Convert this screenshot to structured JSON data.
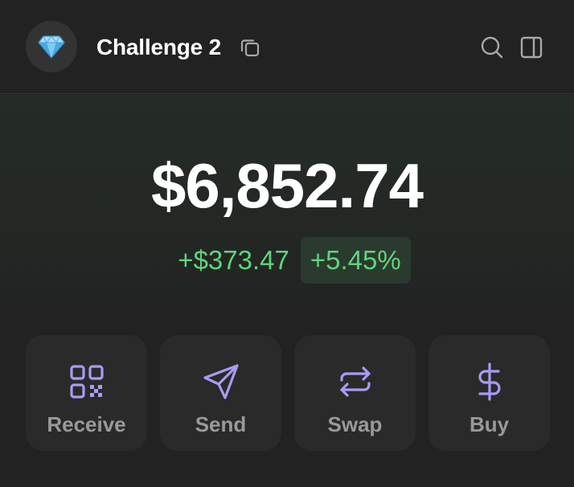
{
  "header": {
    "account_name": "Challenge 2",
    "avatar_icon": "gem-icon",
    "copy_icon": "copy-icon",
    "search_icon": "search-icon",
    "panel_icon": "side-panel-icon"
  },
  "balance": {
    "total": "$6,852.74",
    "change_value": "+$373.47",
    "change_percent": "+5.45%"
  },
  "actions": [
    {
      "label": "Receive",
      "icon": "qr-code-icon"
    },
    {
      "label": "Send",
      "icon": "send-icon"
    },
    {
      "label": "Swap",
      "icon": "swap-icon"
    },
    {
      "label": "Buy",
      "icon": "dollar-icon"
    }
  ],
  "colors": {
    "background": "#222222",
    "accent": "#a99bf0",
    "positive": "#5ed47c",
    "positive_bg": "#2b3a2e",
    "button_bg": "#2a2a2a",
    "label_gray": "#999999"
  }
}
